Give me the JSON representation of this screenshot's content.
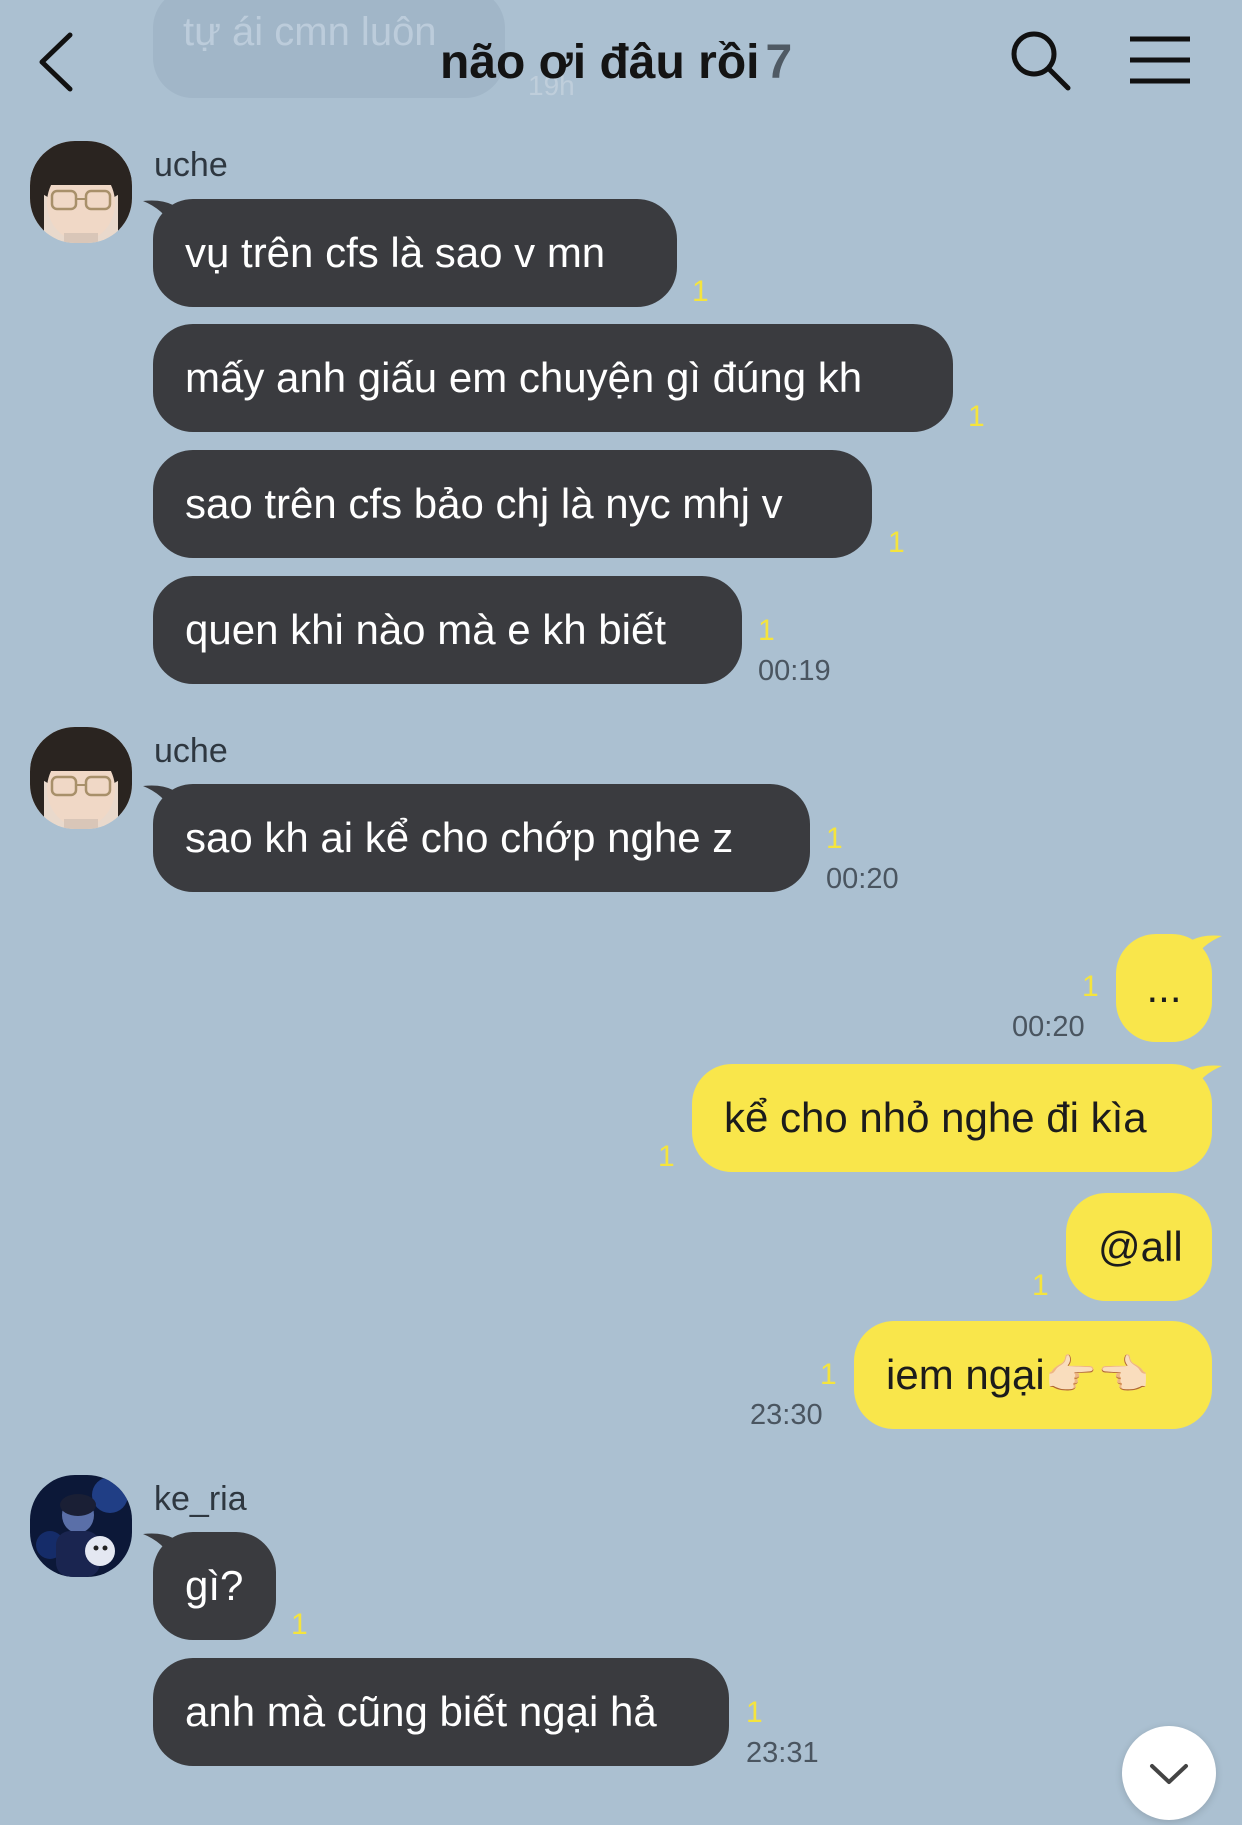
{
  "ghost": {
    "text": "tự ái cmn luôn",
    "meta": "19h"
  },
  "header": {
    "title": "não ơi đâu rồi",
    "member_count": "7"
  },
  "icons": {
    "back": "chevron-left-icon",
    "search": "search-icon",
    "menu": "hamburger-menu-icon",
    "scroll_down": "chevron-down-icon"
  },
  "colors": {
    "background": "#abc0d1",
    "incoming_bubble": "#3a3b3f",
    "outgoing_bubble": "#f9e64b",
    "unread": "#f5e43d"
  },
  "messages": [
    {
      "sender": "uche",
      "text": "vụ trên cfs là sao v mn",
      "unread": "1"
    },
    {
      "text": "mấy anh giấu em chuyện gì đúng kh",
      "unread": "1"
    },
    {
      "text": "sao trên cfs bảo chj là nyc mhj v",
      "unread": "1"
    },
    {
      "text": "quen khi nào mà e kh biết",
      "unread": "1",
      "time": "00:19"
    },
    {
      "sender": "uche",
      "text": "sao kh ai kể cho chớp nghe z",
      "unread": "1",
      "time": "00:20"
    },
    {
      "text": "...",
      "unread": "1",
      "time": "00:20"
    },
    {
      "text": "kể cho nhỏ nghe đi kìa",
      "unread": "1"
    },
    {
      "text": "@all",
      "unread": "1"
    },
    {
      "text": "iem ngại👉🏻👈🏻",
      "unread": "1",
      "time": "23:30"
    },
    {
      "sender": "ke_ria",
      "text": "gì?",
      "unread": "1"
    },
    {
      "text": "anh mà cũng biết ngại hả",
      "unread": "1",
      "time": "23:31"
    }
  ]
}
